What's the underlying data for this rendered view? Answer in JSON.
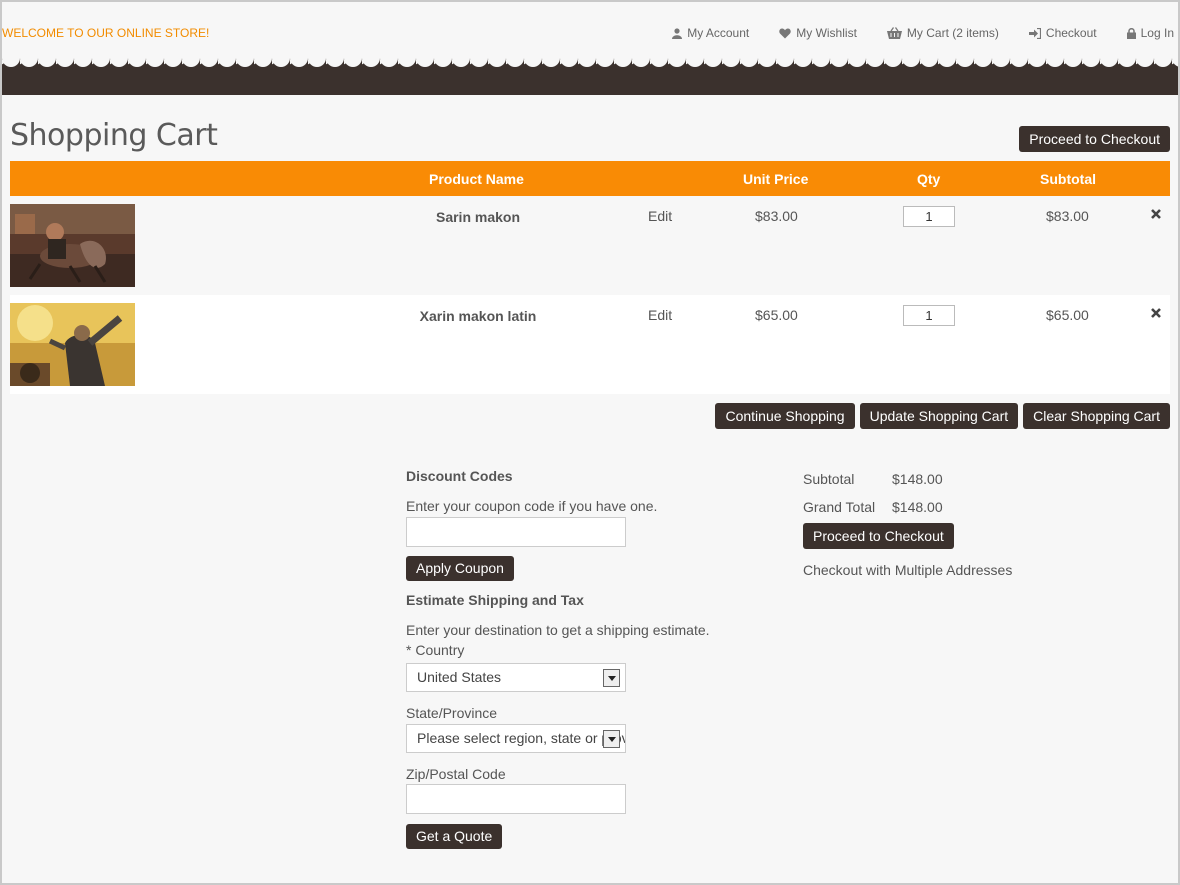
{
  "header": {
    "welcome": "WELCOME TO OUR ONLINE STORE!",
    "links": {
      "account": "My Account",
      "wishlist": "My Wishlist",
      "cart": "My Cart (2 items)",
      "checkout": "Checkout",
      "login": "Log In"
    }
  },
  "page": {
    "title": "Shopping Cart",
    "proceed_top": "Proceed to Checkout"
  },
  "table": {
    "headers": {
      "product_name": "Product Name",
      "unit_price": "Unit Price",
      "qty": "Qty",
      "subtotal": "Subtotal"
    },
    "rows": [
      {
        "name": "Sarin makon",
        "edit": "Edit",
        "price": "$83.00",
        "qty": "1",
        "subtotal": "$83.00"
      },
      {
        "name": "Xarin makon latin",
        "edit": "Edit",
        "price": "$65.00",
        "qty": "1",
        "subtotal": "$65.00"
      }
    ]
  },
  "cart_actions": {
    "continue": "Continue Shopping",
    "update": "Update Shopping Cart",
    "clear": "Clear Shopping Cart"
  },
  "discount": {
    "title": "Discount Codes",
    "hint": "Enter your coupon code if you have one.",
    "coupon_value": "",
    "apply": "Apply Coupon"
  },
  "shipping": {
    "title": "Estimate Shipping and Tax",
    "hint": "Enter your destination to get a shipping estimate.",
    "country_label": "* Country",
    "country_value": "United States",
    "state_label": "State/Province",
    "state_value": "Please select region, state or province",
    "zip_label": "Zip/Postal Code",
    "zip_value": "",
    "quote": "Get a Quote"
  },
  "totals": {
    "subtotal_label": "Subtotal",
    "subtotal_value": "$148.00",
    "grand_label": "Grand Total",
    "grand_value": "$148.00",
    "proceed": "Proceed to Checkout",
    "multi": "Checkout with Multiple Addresses"
  },
  "colors": {
    "accent": "#f98b05",
    "dark": "#3b312d"
  }
}
